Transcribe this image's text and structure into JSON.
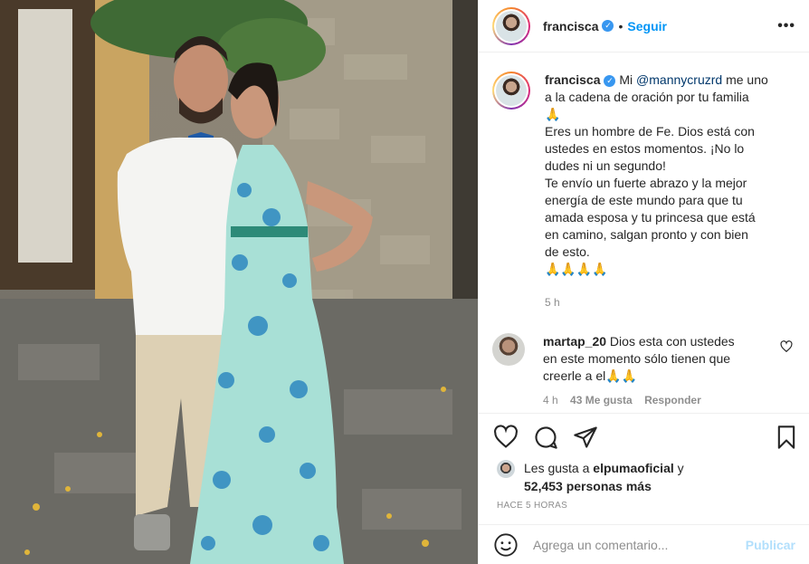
{
  "post": {
    "username": "francisca",
    "follow_label": "Seguir",
    "separator": "•",
    "more_icon": "more-options-icon"
  },
  "caption": {
    "username": "francisca",
    "mention": "@mannycruzrd",
    "line1_after_mention": " me uno",
    "line2": "a la cadena de oración por tu familia",
    "line3": "🙏",
    "line4": "Eres un hombre de Fe. Dios está con",
    "line5": "ustedes en estos momentos. ¡No lo",
    "line6": "dudes ni un segundo!",
    "line7": "Te envío un fuerte abrazo y la mejor",
    "line8": "energía de este mundo para que tu",
    "line9": "amada esposa y tu princesa que está",
    "line10": "en camino, salgan pronto y con bien",
    "line11": "de esto.",
    "line12": "🙏🙏🙏🙏",
    "mi": "Mi",
    "time": "5 h"
  },
  "comment": {
    "username": "martap_20",
    "line1": " Dios esta con ustedes",
    "line2": "en este momento sólo tienen que",
    "line3": "creerle a el🙏🙏",
    "time": "4 h",
    "likes": "43 Me gusta",
    "reply": "Responder"
  },
  "likes": {
    "prefix": "Les gusta a ",
    "user": "elpumaoficial",
    "and": " y",
    "count": "52,453 personas más"
  },
  "timestamp": "HACE 5 HORAS",
  "add_comment": {
    "placeholder": "Agrega un comentario...",
    "publish": "Publicar"
  },
  "colors": {
    "accent": "#0095f6",
    "verified": "#3897f0",
    "publish_disabled": "#b2dffc",
    "muted": "#8e8e8e"
  }
}
